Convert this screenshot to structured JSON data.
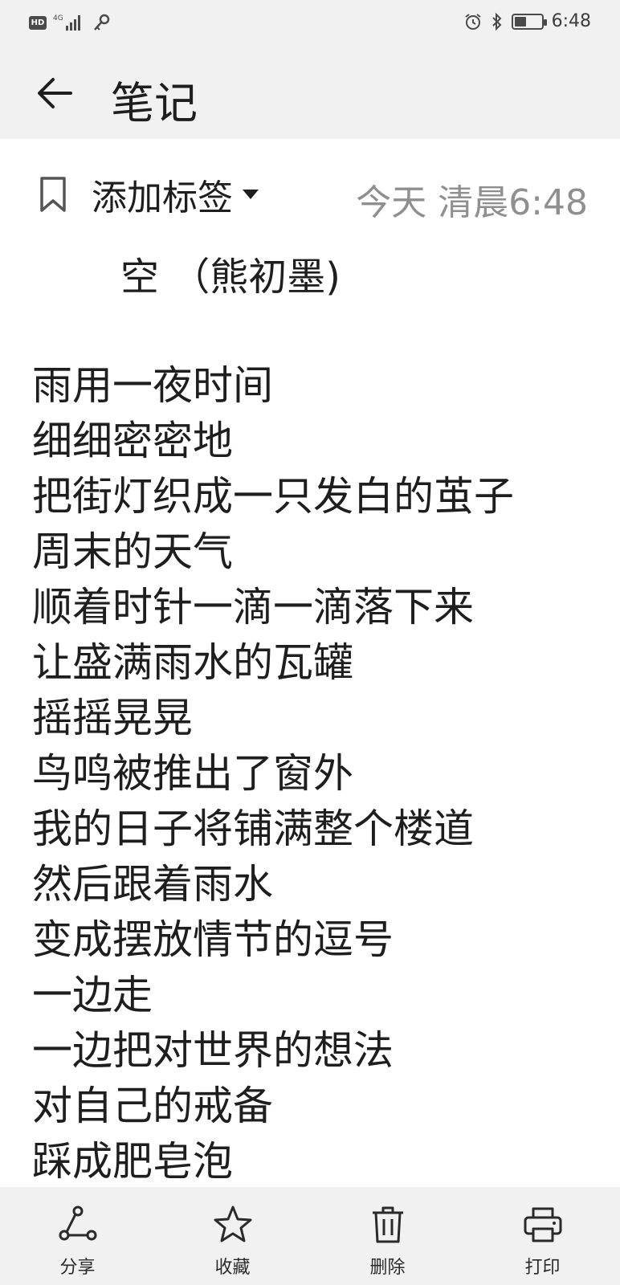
{
  "status_bar": {
    "hd": "HD",
    "network": "4G",
    "time": "6:48",
    "battery_level": 0.45
  },
  "header": {
    "title": "笔记"
  },
  "meta": {
    "tag_label": "添加标签",
    "timestamp": "今天 清晨6:48"
  },
  "note": {
    "title": "空 （熊初墨)",
    "lines": [
      "雨用一夜时间",
      "细细密密地",
      "把街灯织成一只发白的茧子",
      "周末的天气",
      "顺着时针一滴一滴落下来",
      "让盛满雨水的瓦罐",
      "摇摇晃晃",
      "鸟鸣被推出了窗外",
      "我的日子将铺满整个楼道",
      "然后跟着雨水",
      "变成摆放情节的逗号",
      "一边走",
      "一边把对世界的想法",
      "对自己的戒备",
      "踩成肥皂泡"
    ]
  },
  "bottom_bar": {
    "share": "分享",
    "favorite": "收藏",
    "delete": "删除",
    "print": "打印"
  }
}
